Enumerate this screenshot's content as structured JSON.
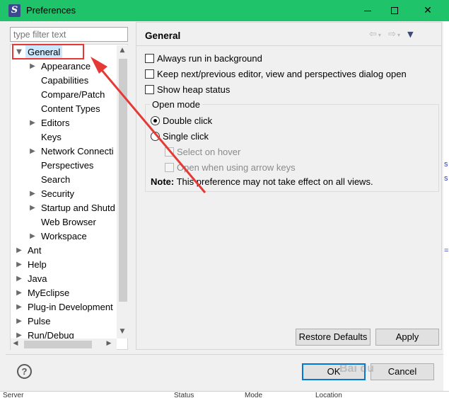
{
  "window": {
    "title": "Preferences",
    "accent": "#1ec36a"
  },
  "filter": {
    "placeholder": "type filter text"
  },
  "tree": {
    "items": [
      {
        "label": "General",
        "expanded": true,
        "selected": true
      },
      {
        "label": "Appearance",
        "has_children": true
      },
      {
        "label": "Capabilities"
      },
      {
        "label": "Compare/Patch"
      },
      {
        "label": "Content Types"
      },
      {
        "label": "Editors",
        "has_children": true
      },
      {
        "label": "Keys"
      },
      {
        "label": "Network Connecti",
        "has_children": true
      },
      {
        "label": "Perspectives"
      },
      {
        "label": "Search"
      },
      {
        "label": "Security",
        "has_children": true
      },
      {
        "label": "Startup and Shutd",
        "has_children": true
      },
      {
        "label": "Web Browser"
      },
      {
        "label": "Workspace",
        "has_children": true
      },
      {
        "label": "Ant",
        "has_children": true
      },
      {
        "label": "Help",
        "has_children": true
      },
      {
        "label": "Java",
        "has_children": true
      },
      {
        "label": "MyEclipse",
        "has_children": true
      },
      {
        "label": "Plug-in Development",
        "has_children": true
      },
      {
        "label": "Pulse",
        "has_children": true
      },
      {
        "label": "Run/Debug",
        "has_children": true
      }
    ]
  },
  "page": {
    "title": "General",
    "options": {
      "always_run_background": "Always run in background",
      "keep_next_prev": "Keep next/previous editor, view and perspectives dialog open",
      "show_heap": "Show heap status"
    },
    "open_mode": {
      "title": "Open mode",
      "double_click": "Double click",
      "single_click": "Single click",
      "select_on_hover": "Select on hover",
      "open_arrow_keys": "Open when using arrow keys",
      "selected": "Double click"
    },
    "note_label": "Note:",
    "note_text": "This preference may not take effect on all views."
  },
  "buttons": {
    "restore_defaults": "Restore Defaults",
    "apply": "Apply",
    "ok": "OK",
    "cancel": "Cancel",
    "help": "?"
  },
  "background_columns": {
    "server": "Server",
    "status": "Status",
    "mode": "Mode",
    "location": "Location"
  },
  "watermark": "Bai du 经验",
  "annotation_color": "#e53935"
}
